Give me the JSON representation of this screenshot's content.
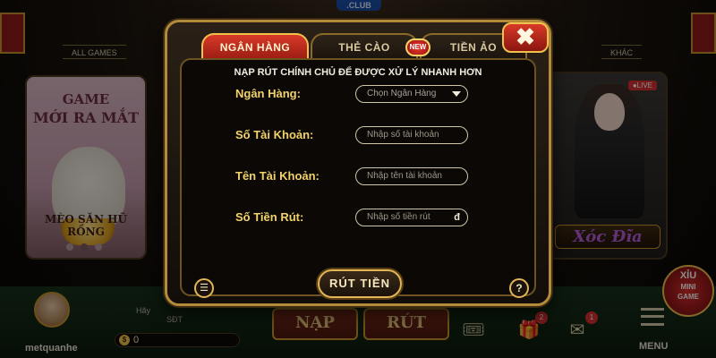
{
  "lobby": {
    "club_tag": ".CLUB",
    "section_all_games": "ALL GAMES",
    "section_other": "KHÁC",
    "featured_card": {
      "title_line1": "GAME",
      "title_line2": "MỚI RA MẮT",
      "footer": "MÈO SĂN HŨ RỒNG",
      "page_index": 2,
      "page_count": 3
    },
    "live_card": {
      "badge": "●LIVE",
      "title": "Xóc Đĩa"
    },
    "minigame_badge": {
      "top": "XỈU",
      "label_line1": "MINI",
      "label_line2": "GAME"
    }
  },
  "bottom_bar": {
    "username": "metquanhe",
    "balance": "0",
    "currency_symbol": "$",
    "hint_fragment_1": "Hãy",
    "hint_fragment_2": "SĐT",
    "deposit_label": "NẠP",
    "withdraw_label": "RÚT",
    "gift_count": "2",
    "mail_count": "1",
    "menu_label": "MENU"
  },
  "modal": {
    "tabs": [
      {
        "label": "NGÂN HÀNG",
        "active": true
      },
      {
        "label": "THẺ CÀO",
        "active": false
      },
      {
        "label": "TIỀN ẢO",
        "active": false
      }
    ],
    "new_badge": "NEW",
    "close_glyph": "✖",
    "notice": "NẠP RÚT CHÍNH CHỦ ĐỂ ĐƯỢC XỬ LÝ NHANH HƠN",
    "form": {
      "bank": {
        "label": "Ngân Hàng:",
        "value": "Chọn Ngân Hàng"
      },
      "account_number": {
        "label": "Số Tài Khoản:",
        "placeholder": "Nhập số tài  khoản"
      },
      "account_name": {
        "label": "Tên Tài Khoản:",
        "placeholder": "Nhập tên tài khoản"
      },
      "amount": {
        "label": "Số Tiền Rút:",
        "placeholder": "Nhập số tiền rút",
        "currency": "đ"
      }
    },
    "submit_label": "RÚT TIỀN",
    "history_glyph": "☰",
    "help_glyph": "?"
  },
  "colors": {
    "accent_gold": "#e2b454",
    "active_tab_red": "#d83a28",
    "label_yellow": "#f2d36b"
  }
}
